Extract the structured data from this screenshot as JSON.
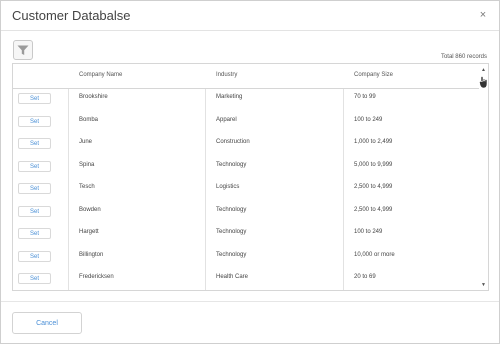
{
  "dialog": {
    "title": "Customer Databalse",
    "close_label": "×"
  },
  "toolbar": {
    "filter_icon": "filter-icon",
    "total_records": "Total 860 records"
  },
  "grid": {
    "columns": [
      "",
      "Company Name",
      "Industry",
      "Company Size"
    ],
    "set_label": "Set",
    "rows": [
      {
        "company": "Brookshire",
        "industry": "Marketing",
        "size": "70 to 99"
      },
      {
        "company": "Bomba",
        "industry": "Apparel",
        "size": "100 to 249"
      },
      {
        "company": "June",
        "industry": "Construction",
        "size": "1,000 to 2,499"
      },
      {
        "company": "Spina",
        "industry": "Technology",
        "size": "5,000 to 9,999"
      },
      {
        "company": "Tesch",
        "industry": "Logistics",
        "size": "2,500 to 4,999"
      },
      {
        "company": "Bowden",
        "industry": "Technology",
        "size": "2,500 to 4,999"
      },
      {
        "company": "Hargett",
        "industry": "Technology",
        "size": "100 to 249"
      },
      {
        "company": "Billington",
        "industry": "Technology",
        "size": "10,000 or more"
      },
      {
        "company": "Fredericksen",
        "industry": "Health Care",
        "size": "20 to 69"
      }
    ]
  },
  "footer": {
    "cancel_label": "Cancel"
  },
  "colors": {
    "accent": "#4a8fd6",
    "border": "#d6d6d6"
  }
}
